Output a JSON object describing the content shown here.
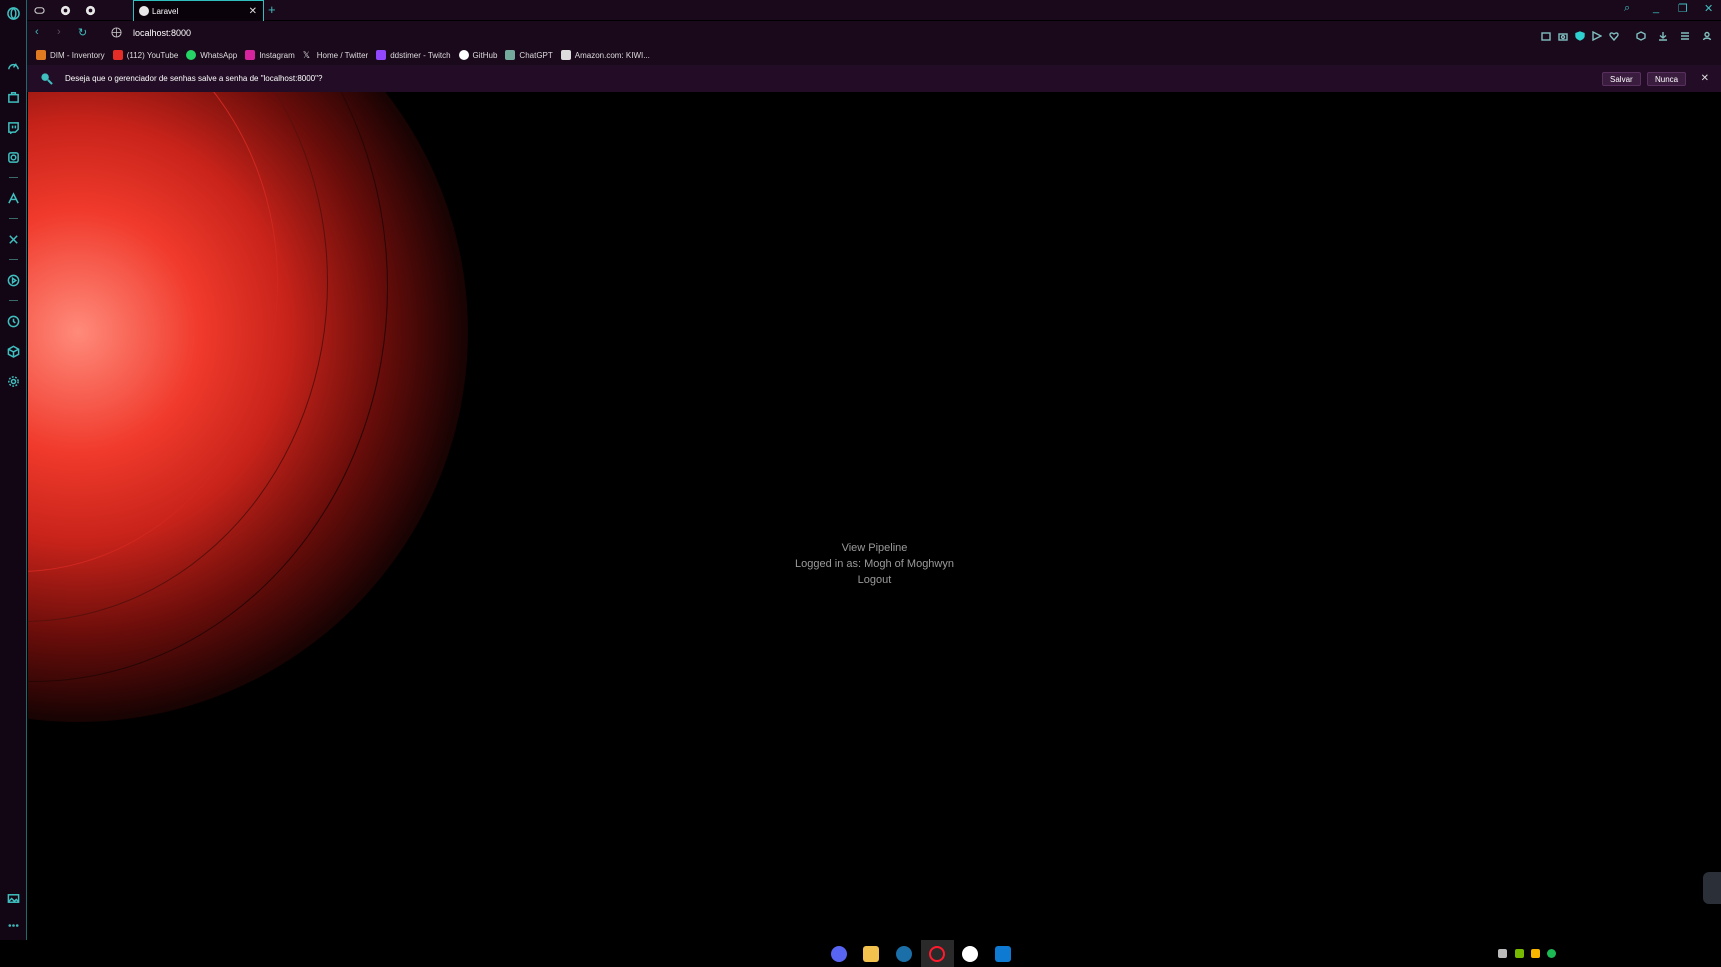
{
  "browser": {
    "active_tab_title": "Laravel",
    "url": "localhost:8000",
    "accent_color": "#3fbfbf"
  },
  "bookmarks": [
    {
      "label": "DIM - Inventory",
      "color": "#e07a20"
    },
    {
      "label": "(112) YouTube",
      "color": "#e52d27"
    },
    {
      "label": "WhatsApp",
      "color": "#25d366"
    },
    {
      "label": "Instagram",
      "color": "#d6249f"
    },
    {
      "label": "Home / Twitter",
      "color": "#dddddd"
    },
    {
      "label": "ddstimer - Twitch",
      "color": "#9146ff"
    },
    {
      "label": "GitHub",
      "color": "#ffffff"
    },
    {
      "label": "ChatGPT",
      "color": "#74aa9c"
    },
    {
      "label": "Amazon.com: KIWI...",
      "color": "#dddddd"
    }
  ],
  "password_prompt": {
    "message": "Deseja que o gerenciador de senhas salve a senha de \"localhost:8000\"?",
    "save_label": "Salvar",
    "never_label": "Nunca"
  },
  "content": {
    "view_pipeline": "View Pipeline",
    "logged_in": "Logged in as: Mogh of Moghwyn",
    "logout": "Logout"
  }
}
